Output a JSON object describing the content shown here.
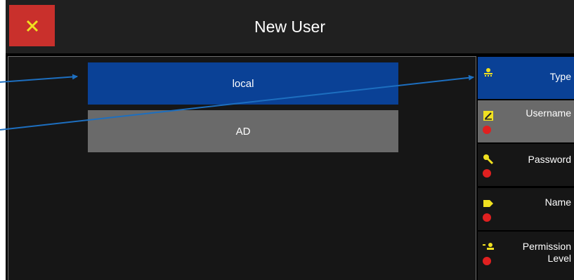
{
  "header": {
    "title": "New User",
    "close_icon": "close-icon"
  },
  "main": {
    "options": [
      {
        "label": "local",
        "selected": true
      },
      {
        "label": "AD",
        "selected": false
      }
    ]
  },
  "sidebar": {
    "items": [
      {
        "label": "Type",
        "icon": "user-type-icon",
        "active": true,
        "required_missing": false
      },
      {
        "label": "Username",
        "icon": "pencil-icon",
        "active": false,
        "required_missing": true
      },
      {
        "label": "Password",
        "icon": "key-icon",
        "active": false,
        "required_missing": true
      },
      {
        "label": "Name",
        "icon": "tag-icon",
        "active": false,
        "required_missing": true
      },
      {
        "label": "Permission Level",
        "icon": "permission-icon",
        "active": false,
        "required_missing": true
      }
    ]
  },
  "colors": {
    "accent_blue": "#0a4196",
    "close_red": "#c9302c",
    "icon_yellow": "#f0e020",
    "warning_red": "#e02020",
    "annotation_arrow": "#1d6fc0"
  }
}
